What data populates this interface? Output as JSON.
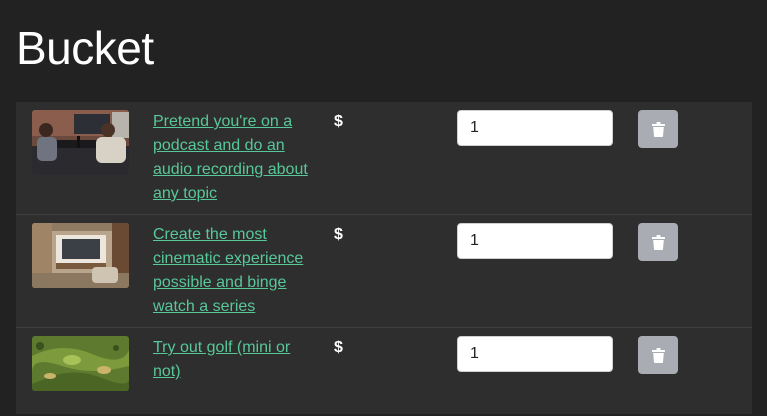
{
  "page": {
    "title": "Bucket"
  },
  "colors": {
    "background": "#222222",
    "table_background": "#2e2e2e",
    "link": "#58c79a",
    "delete_button": "#a9acb3"
  },
  "items": [
    {
      "title": "Pretend you're on a podcast and do an audio recording about any topic",
      "price": "$",
      "quantity": "1",
      "thumbnail_icon": "podcast-studio-photo",
      "delete_icon": "trash-icon"
    },
    {
      "title": "Create the most cinematic experience possible and binge watch a series",
      "price": "$",
      "quantity": "1",
      "thumbnail_icon": "home-theater-photo",
      "delete_icon": "trash-icon"
    },
    {
      "title": "Try out golf (mini or not)",
      "price": "$",
      "quantity": "1",
      "thumbnail_icon": "golf-course-aerial-photo",
      "delete_icon": "trash-icon"
    }
  ]
}
